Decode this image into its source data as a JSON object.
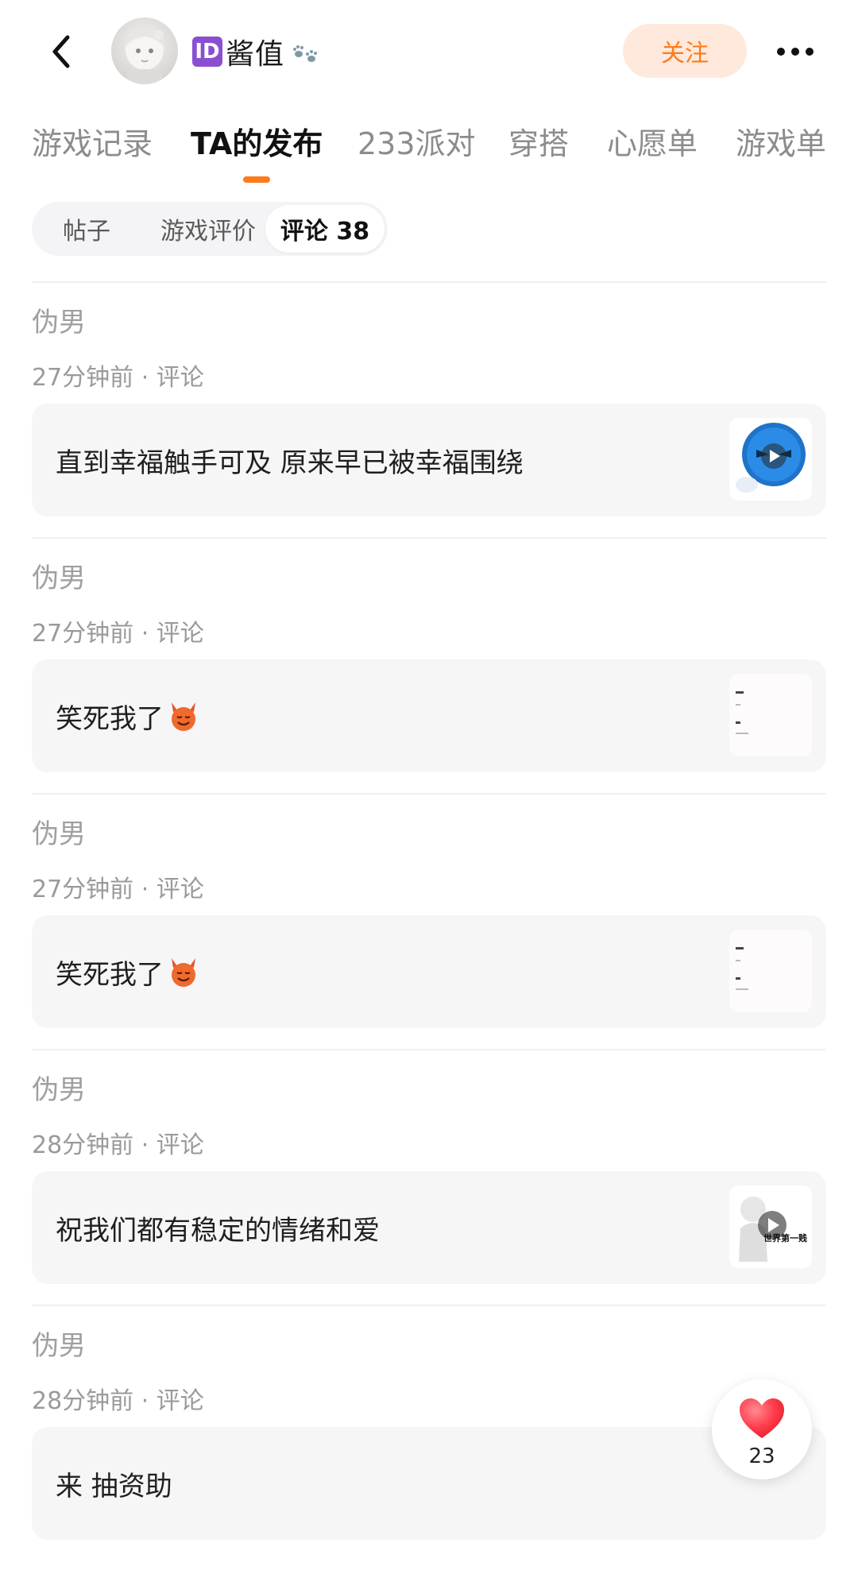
{
  "header": {
    "id_badge": "ID",
    "username": "酱值",
    "follow_label": "关注"
  },
  "tabs": [
    {
      "label": "游戏记录",
      "active": false
    },
    {
      "label": "TA的发布",
      "active": true
    },
    {
      "label": "233派对",
      "active": false
    },
    {
      "label": "穿搭",
      "active": false
    },
    {
      "label": "心愿单",
      "active": false
    },
    {
      "label": "游戏单",
      "active": false
    }
  ],
  "subtabs": [
    {
      "label": "帖子",
      "active": false
    },
    {
      "label": "游戏评价",
      "active": false
    },
    {
      "label": "评论 38",
      "active": true
    }
  ],
  "feed": [
    {
      "author": "伪男",
      "meta": "27分钟前 · 评论",
      "text": "直到幸福触手可及 原来早已被幸福围绕",
      "thumb": "blue-emoji-video-thumbnail"
    },
    {
      "author": "伪男",
      "meta": "27分钟前 · 评论",
      "text": "笑死我了",
      "emoji": "devil-emoji",
      "thumb": "text-screenshot-thumbnail"
    },
    {
      "author": "伪男",
      "meta": "27分钟前 · 评论",
      "text": "笑死我了",
      "emoji": "devil-emoji",
      "thumb": "text-screenshot-thumbnail"
    },
    {
      "author": "伪男",
      "meta": "28分钟前 · 评论",
      "text": "祝我们都有稳定的情绪和爱",
      "thumb": "figure-video-thumbnail",
      "thumb_caption": "世界第一贱"
    },
    {
      "author": "伪男",
      "meta": "28分钟前 · 评论",
      "text": "来 抽资助"
    }
  ],
  "like": {
    "count": "23"
  },
  "colors": {
    "accent": "#ff7a1a",
    "follow_bg": "#ffe9dc",
    "id_badge": "#8a4fd1",
    "heart": "#ff3b4a"
  }
}
